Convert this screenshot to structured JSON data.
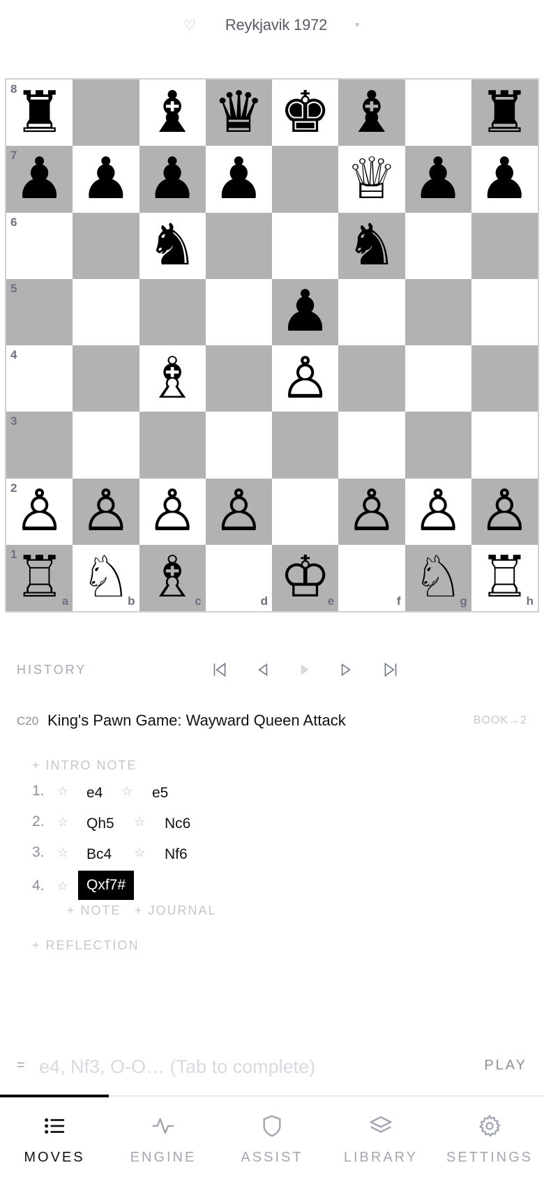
{
  "header": {
    "heart_icon": "heart-outline-icon",
    "title": "Reykjavik 1972",
    "caret_icon": "caret-down-icon"
  },
  "board": {
    "light_color": "#ffffff",
    "dark_color": "#b2b2b2",
    "rank_labels": [
      "8",
      "7",
      "6",
      "5",
      "4",
      "3",
      "2",
      "1"
    ],
    "file_labels": [
      "a",
      "b",
      "c",
      "d",
      "e",
      "f",
      "g",
      "h"
    ],
    "position": [
      [
        "r",
        "",
        "b",
        "q",
        "k",
        "b",
        "",
        "r"
      ],
      [
        "p",
        "p",
        "p",
        "p",
        "",
        "Q",
        "p",
        "p"
      ],
      [
        "",
        "",
        "n",
        "",
        "",
        "n",
        "",
        ""
      ],
      [
        "",
        "",
        "",
        "",
        "p",
        "",
        "",
        ""
      ],
      [
        "",
        "",
        "B",
        "",
        "P",
        "",
        "",
        ""
      ],
      [
        "",
        "",
        "",
        "",
        "",
        "",
        "",
        ""
      ],
      [
        "P",
        "P",
        "P",
        "P",
        "",
        "P",
        "P",
        "P"
      ],
      [
        "R",
        "N",
        "B",
        "",
        "K",
        "",
        "N",
        "R"
      ]
    ]
  },
  "history": {
    "label": "HISTORY",
    "nav": [
      "first-move-icon",
      "prev-move-icon",
      "play-icon",
      "next-move-icon",
      "last-move-icon"
    ]
  },
  "opening": {
    "eco": "C20",
    "name": "King's Pawn Game: Wayward Queen Attack",
    "book": "BOOK→2"
  },
  "notes": {
    "intro": "+ INTRO NOTE",
    "note": "+ NOTE",
    "journal": "+ JOURNAL",
    "reflection": "+ REFLECTION"
  },
  "moves": [
    {
      "num": "1.",
      "white": "e4",
      "black": "e5"
    },
    {
      "num": "2.",
      "white": "Qh5",
      "black": "Nc6"
    },
    {
      "num": "3.",
      "white": "Bc4",
      "black": "Nf6"
    },
    {
      "num": "4.",
      "white": "Qxf7#",
      "black": ""
    }
  ],
  "star_glyph": "☆",
  "input": {
    "prefix": "=",
    "placeholder": "e4, Nf3, O-O… (Tab to complete)",
    "value": "",
    "play_label": "PLAY"
  },
  "tabs": [
    {
      "label": "MOVES",
      "icon": "list-icon",
      "active": true
    },
    {
      "label": "ENGINE",
      "icon": "pulse-icon",
      "active": false
    },
    {
      "label": "ASSIST",
      "icon": "shield-icon",
      "active": false
    },
    {
      "label": "LIBRARY",
      "icon": "layers-icon",
      "active": false
    },
    {
      "label": "SETTINGS",
      "icon": "gear-icon",
      "active": false
    }
  ],
  "colors": {
    "accent": "#000000",
    "muted": "#8a8f9c",
    "faint": "#c4c7ce"
  }
}
